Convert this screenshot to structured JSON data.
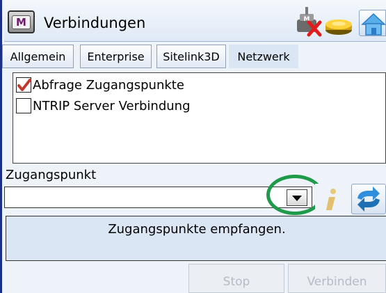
{
  "window": {
    "title": "Verbindungen",
    "app_icon_letter": "M"
  },
  "status_icons": [
    "device-disconnected-icon",
    "gnss-receiver-icon"
  ],
  "tabs": [
    {
      "label": "Allgemein",
      "active": false
    },
    {
      "label": "Enterprise",
      "active": false
    },
    {
      "label": "Sitelink3D",
      "active": false
    },
    {
      "label": "Netzwerk",
      "active": true
    }
  ],
  "options": [
    {
      "label": "Abfrage Zugangspunkte",
      "checked": true
    },
    {
      "label": "NTRIP Server Verbindung",
      "checked": false
    }
  ],
  "access_point": {
    "label": "Zugangspunkt",
    "value": ""
  },
  "status_message": "Zugangspunkte empfangen.",
  "buttons": {
    "stop": "Stop",
    "connect": "Verbinden"
  },
  "colors": {
    "frame": "#1c2f86",
    "highlight": "#1f9a4a",
    "check": "#c0392b",
    "disabled_text": "#b5bcc7"
  }
}
